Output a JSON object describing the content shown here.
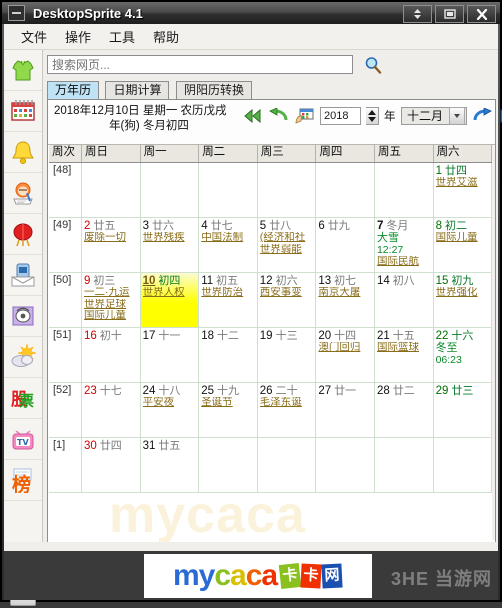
{
  "window": {
    "title": "DesktopSprite 4.1",
    "buttons": {
      "roll": "roll-up",
      "maximize": "maximize",
      "close": "close"
    }
  },
  "menubar": {
    "items": [
      "文件",
      "操作",
      "工具",
      "帮助"
    ]
  },
  "sidebar": {
    "items": [
      {
        "name": "shirt-icon",
        "label": "装扮"
      },
      {
        "name": "calendar-icon",
        "label": "万年历"
      },
      {
        "name": "bell-icon",
        "label": "提醒"
      },
      {
        "name": "notes-icon",
        "label": "记事"
      },
      {
        "name": "lantern-icon",
        "label": "节日"
      },
      {
        "name": "mail-icon",
        "label": "短信"
      },
      {
        "name": "phone-icon",
        "label": "电话"
      },
      {
        "name": "weather-icon",
        "label": "天气"
      },
      {
        "name": "stock-icon",
        "label": "股"
      },
      {
        "name": "tv-icon",
        "label": "电视"
      },
      {
        "name": "rank-icon",
        "label": "榜"
      }
    ],
    "scroll_up": "▲",
    "scroll_down": "▼"
  },
  "search": {
    "placeholder": "搜索网页...",
    "value": "",
    "button_icon": "search-icon"
  },
  "tabs": [
    {
      "label": "万年历",
      "active": true
    },
    {
      "label": "日期计算",
      "active": false
    },
    {
      "label": "阴阳历转换",
      "active": false
    }
  ],
  "calendar_header": {
    "line1": "2018年12月10日 星期一 农历戊戌",
    "line2": "年(狗) 冬月初四",
    "year_value": "2018",
    "year_unit": "年",
    "month_value": "十二月",
    "nav": {
      "prev_year": "«",
      "prev_month": "←",
      "today": "today-icon",
      "next_month": "→",
      "next_year": "»"
    }
  },
  "grid": {
    "week_col_header": "周次",
    "day_headers": [
      "周日",
      "周一",
      "周二",
      "周三",
      "周四",
      "周五",
      "周六"
    ],
    "rows": [
      {
        "week": "[48]",
        "days": [
          {
            "num": "",
            "lunar": "",
            "events": []
          },
          {
            "num": "",
            "lunar": "",
            "events": []
          },
          {
            "num": "",
            "lunar": "",
            "events": []
          },
          {
            "num": "",
            "lunar": "",
            "events": []
          },
          {
            "num": "",
            "lunar": "",
            "events": []
          },
          {
            "num": "",
            "lunar": "",
            "events": []
          },
          {
            "num": "1",
            "lunar": "廿四",
            "type": "sat",
            "events": [
              "世界艾滋"
            ]
          }
        ]
      },
      {
        "week": "[49]",
        "days": [
          {
            "num": "2",
            "lunar": "廿五",
            "type": "sun",
            "events": [
              "废除一切"
            ]
          },
          {
            "num": "3",
            "lunar": "廿六",
            "type": "wd",
            "events": [
              "世界残疾"
            ]
          },
          {
            "num": "4",
            "lunar": "廿七",
            "type": "wd",
            "events": [
              "中国法制"
            ]
          },
          {
            "num": "5",
            "lunar": "廿八",
            "type": "wd",
            "events": [
              "(经济和社",
              "世界弱能"
            ]
          },
          {
            "num": "6",
            "lunar": "廿九",
            "type": "wd",
            "events": []
          },
          {
            "num": "7",
            "lunar": "冬月",
            "type": "wd",
            "bold": true,
            "jieqi": "大雪",
            "jieqi_time": "12:27",
            "events": [
              "国际民航"
            ]
          },
          {
            "num": "8",
            "lunar": "初二",
            "type": "sat",
            "events": [
              "国际儿童"
            ]
          }
        ]
      },
      {
        "week": "[50]",
        "days": [
          {
            "num": "9",
            "lunar": "初三",
            "type": "sun",
            "events": [
              "一二·九运",
              "世界足球",
              "国际儿童"
            ]
          },
          {
            "num": "10",
            "lunar": "初四",
            "type": "today",
            "events": [
              "世界人权"
            ]
          },
          {
            "num": "11",
            "lunar": "初五",
            "type": "wd",
            "events": [
              "世界防治"
            ]
          },
          {
            "num": "12",
            "lunar": "初六",
            "type": "wd",
            "events": [
              "西安事变"
            ]
          },
          {
            "num": "13",
            "lunar": "初七",
            "type": "wd",
            "events": [
              "南京大屠"
            ]
          },
          {
            "num": "14",
            "lunar": "初八",
            "type": "wd",
            "events": []
          },
          {
            "num": "15",
            "lunar": "初九",
            "type": "sat",
            "events": [
              "世界强化"
            ]
          }
        ]
      },
      {
        "week": "[51]",
        "days": [
          {
            "num": "16",
            "lunar": "初十",
            "type": "sun",
            "events": []
          },
          {
            "num": "17",
            "lunar": "十一",
            "type": "wd",
            "events": []
          },
          {
            "num": "18",
            "lunar": "十二",
            "type": "wd",
            "events": []
          },
          {
            "num": "19",
            "lunar": "十三",
            "type": "wd",
            "events": []
          },
          {
            "num": "20",
            "lunar": "十四",
            "type": "wd",
            "events": [
              "澳门回归"
            ]
          },
          {
            "num": "21",
            "lunar": "十五",
            "type": "wd",
            "events": [
              "国际篮球"
            ]
          },
          {
            "num": "22",
            "lunar": "十六",
            "type": "sat",
            "jieqi": "冬至",
            "jieqi_time": "06:23",
            "events": []
          }
        ]
      },
      {
        "week": "[52]",
        "days": [
          {
            "num": "23",
            "lunar": "十七",
            "type": "sun",
            "events": []
          },
          {
            "num": "24",
            "lunar": "十八",
            "type": "wd",
            "events": [
              "平安夜"
            ]
          },
          {
            "num": "25",
            "lunar": "十九",
            "type": "wd",
            "events": [
              "圣诞节"
            ]
          },
          {
            "num": "26",
            "lunar": "二十",
            "type": "wd",
            "events": [
              "毛泽东诞"
            ]
          },
          {
            "num": "27",
            "lunar": "廿一",
            "type": "wd",
            "events": []
          },
          {
            "num": "28",
            "lunar": "廿二",
            "type": "wd",
            "events": []
          },
          {
            "num": "29",
            "lunar": "廿三",
            "type": "sat",
            "events": []
          }
        ]
      },
      {
        "week": "[1]",
        "days": [
          {
            "num": "30",
            "lunar": "廿四",
            "type": "sun",
            "events": []
          },
          {
            "num": "31",
            "lunar": "廿五",
            "type": "wd",
            "events": []
          },
          {
            "num": "",
            "lunar": "",
            "events": []
          },
          {
            "num": "",
            "lunar": "",
            "events": []
          },
          {
            "num": "",
            "lunar": "",
            "events": []
          },
          {
            "num": "",
            "lunar": "",
            "events": []
          },
          {
            "num": "",
            "lunar": "",
            "events": []
          }
        ]
      }
    ]
  },
  "watermark": {
    "text": "mycaca"
  },
  "footer": {
    "logo_text": "mycaca",
    "logo_tiles": [
      "卡",
      "卡",
      "网"
    ],
    "corner_watermark": "3HE 当游网"
  },
  "colors": {
    "today_highlight": "#ffff00",
    "sunday": "#d40000",
    "saturday": "#007000",
    "event_link": "#8a6d1a",
    "jieqi": "#0a8a2a",
    "tab_active": "#bfe3f5"
  }
}
